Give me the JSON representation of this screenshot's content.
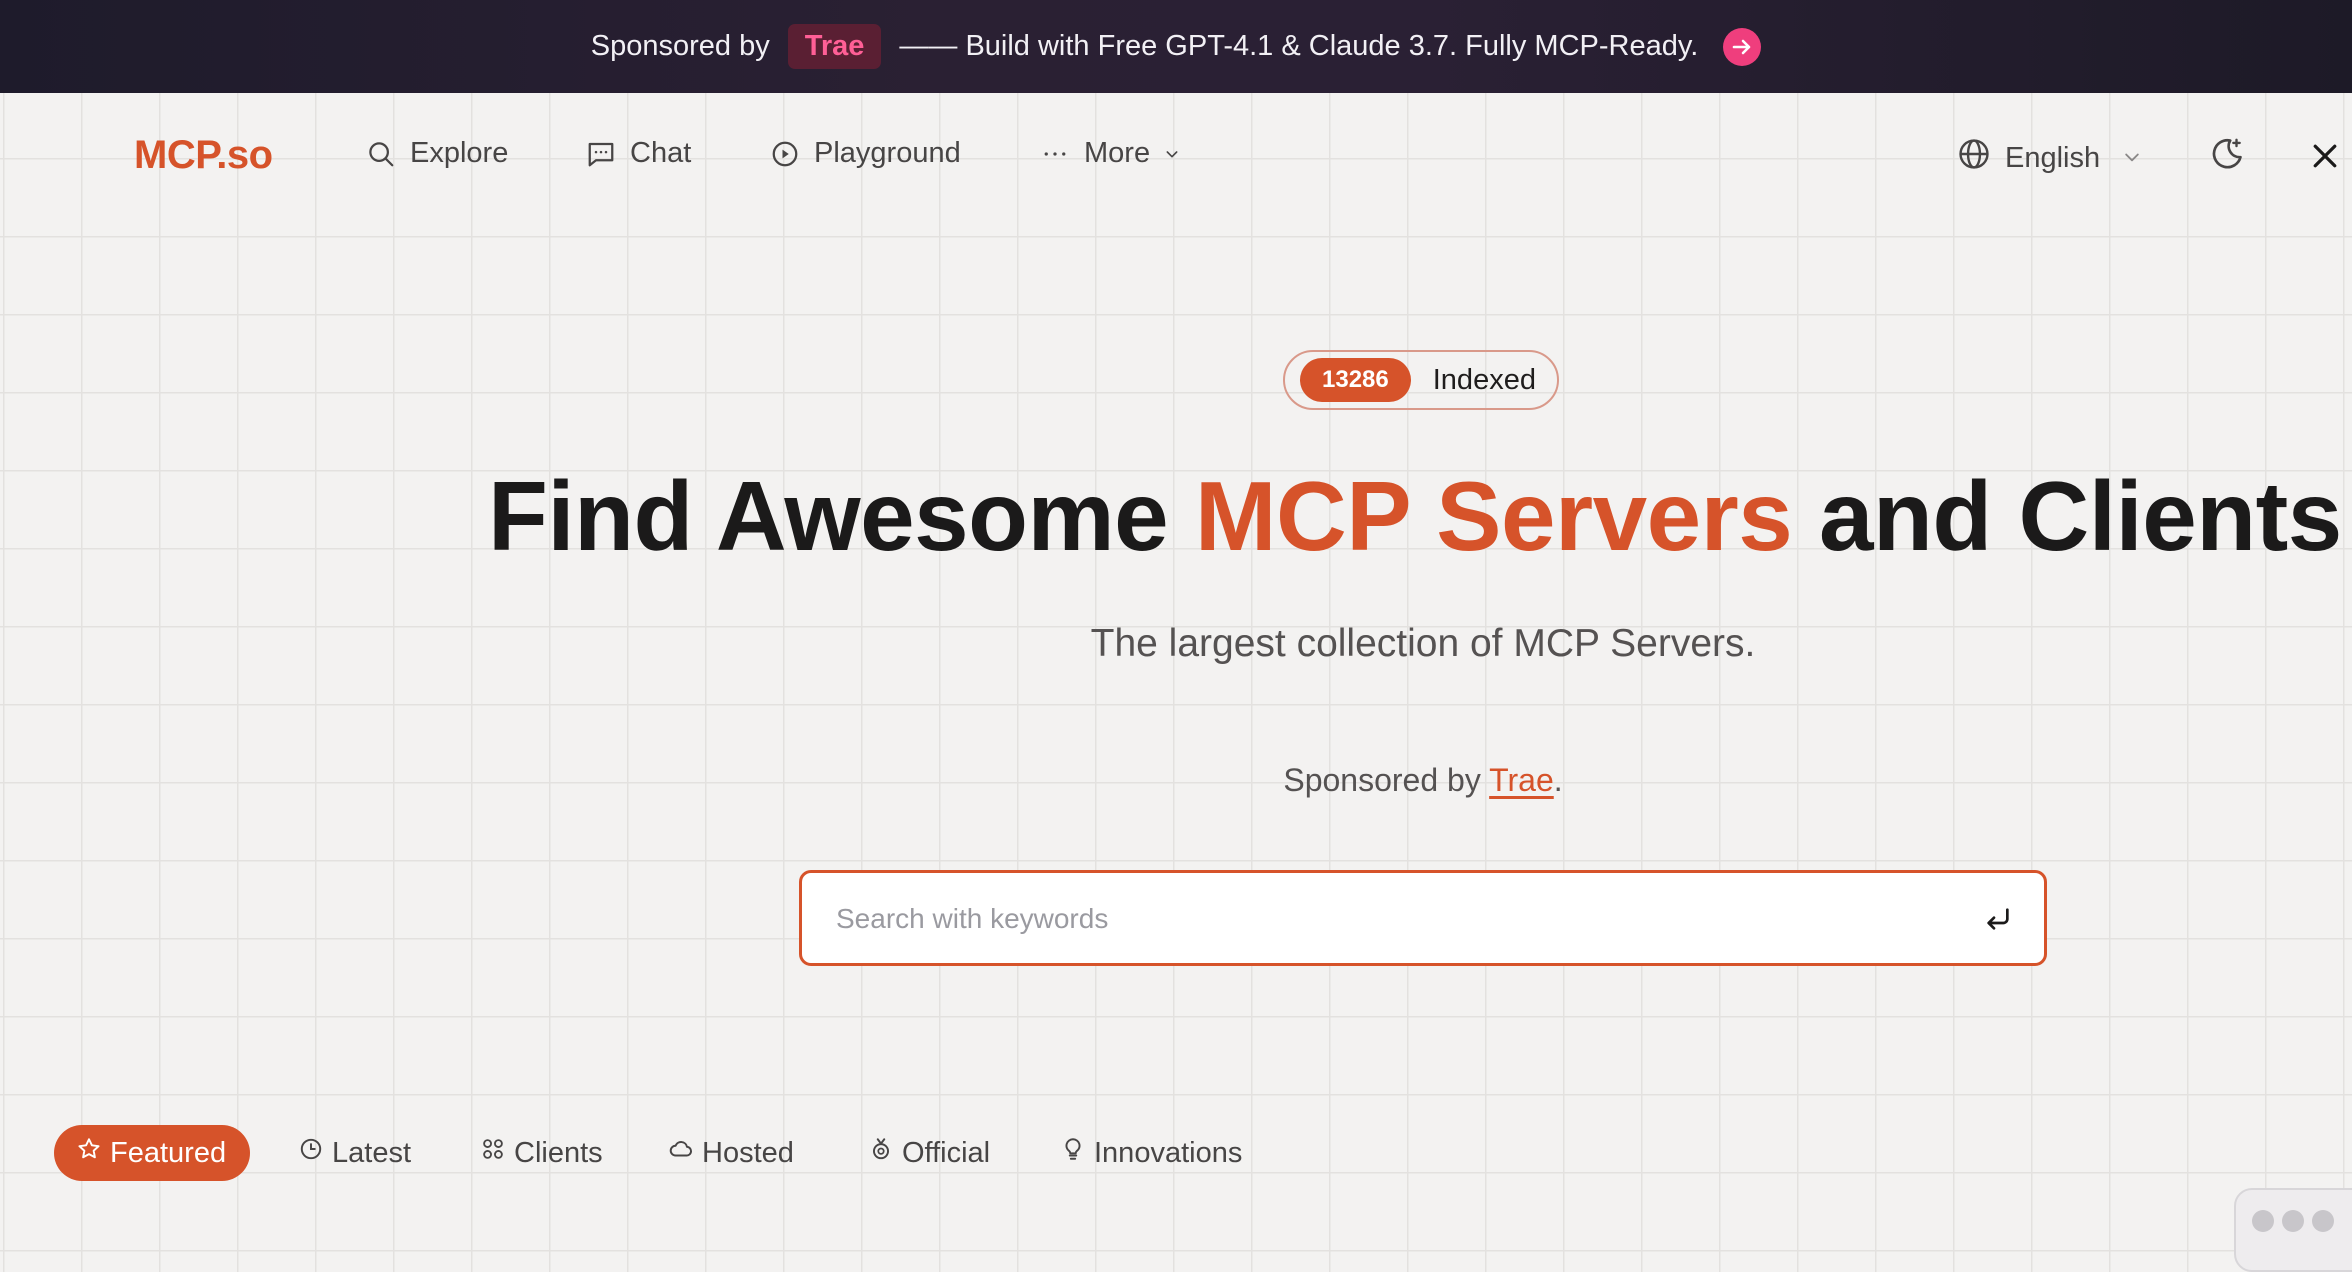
{
  "banner": {
    "sponsored_by": "Sponsored by",
    "brand": "Trae",
    "message": "—— Build with Free GPT-4.1 & Claude 3.7. Fully MCP-Ready."
  },
  "nav": {
    "logo": "MCP.so",
    "items": [
      {
        "label": "Explore",
        "icon": "search-icon"
      },
      {
        "label": "Chat",
        "icon": "chat-icon"
      },
      {
        "label": "Playground",
        "icon": "play-circle-icon"
      },
      {
        "label": "More",
        "icon": "ellipsis-icon"
      }
    ],
    "language": "English"
  },
  "hero": {
    "count": "13286",
    "count_label": "Indexed",
    "title_before": "Find Awesome",
    "title_accent": "MCP Servers",
    "title_after": "and Clients",
    "subtitle": "The largest collection of MCP Servers.",
    "sponsor_prefix": "Sponsored by",
    "sponsor_name": "Trae",
    "sponsor_suffix": "."
  },
  "search": {
    "placeholder": "Search with keywords"
  },
  "tabs": [
    {
      "label": "Featured",
      "icon": "star-icon",
      "active": true
    },
    {
      "label": "Latest",
      "icon": "clock-icon",
      "active": false
    },
    {
      "label": "Clients",
      "icon": "grid-icon",
      "active": false
    },
    {
      "label": "Hosted",
      "icon": "cloud-icon",
      "active": false
    },
    {
      "label": "Official",
      "icon": "badge-icon",
      "active": false
    },
    {
      "label": "Innovations",
      "icon": "lightbulb-icon",
      "active": false
    }
  ],
  "colors": {
    "accent": "#d6532a",
    "banner_bg": "#231e2d",
    "banner_brand": "#ff5f96"
  }
}
